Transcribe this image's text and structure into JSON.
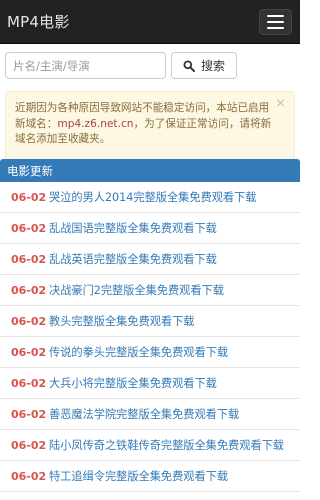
{
  "navbar": {
    "brand": "MP4电影",
    "menu_icon": "hamburger-menu-icon"
  },
  "search": {
    "placeholder": "片名/主演/导演",
    "value": "",
    "button_label": "搜索",
    "button_icon": "search-icon"
  },
  "notice": {
    "text_before": "近期因为各种原因导致网站不能稳定访问，本站已启用新域名：",
    "domain": "mp4.z6.net.cn",
    "text_after": "，为了保证正常访问，请将新域名添加至收藏夹。",
    "close_glyph": "×",
    "colors": {
      "background": "#fcf8e3",
      "text": "#8a6d3b",
      "domain": "#a94442"
    }
  },
  "movies": {
    "heading": "电影更新",
    "items": [
      {
        "date": "06-02",
        "title": "哭泣的男人2014完整版全集免费观看下载"
      },
      {
        "date": "06-02",
        "title": "乱战国语完整版全集免费观看下载"
      },
      {
        "date": "06-02",
        "title": "乱战英语完整版全集免费观看下载"
      },
      {
        "date": "06-02",
        "title": "决战豪门2完整版全集免费观看下载"
      },
      {
        "date": "06-02",
        "title": "教头完整版全集免费观看下载"
      },
      {
        "date": "06-02",
        "title": "传说的拳头完整版全集免费观看下载"
      },
      {
        "date": "06-02",
        "title": "大兵小将完整版全集免费观看下载"
      },
      {
        "date": "06-02",
        "title": "善恶魔法学院完整版全集免费观看下载"
      },
      {
        "date": "06-02",
        "title": "陆小凤传奇之铁鞋传奇完整版全集免费观看下载"
      },
      {
        "date": "06-02",
        "title": "特工追缉令完整版全集免费观看下载"
      }
    ],
    "colors": {
      "heading_bg": "#337ab7",
      "date": "#d9534f",
      "title": "#337ab7"
    }
  }
}
